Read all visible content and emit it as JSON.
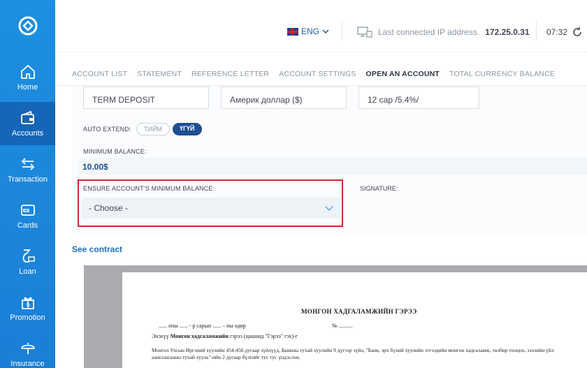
{
  "sidebar": {
    "items": [
      {
        "label": "Home",
        "icon": "home-icon"
      },
      {
        "label": "Accounts",
        "icon": "wallet-icon",
        "active": true
      },
      {
        "label": "Transaction",
        "icon": "transfer-arrows-icon"
      },
      {
        "label": "Cards",
        "icon": "card-icon"
      },
      {
        "label": "Loan",
        "icon": "loan-icon"
      },
      {
        "label": "Promotion",
        "icon": "gift-icon"
      },
      {
        "label": "Insurance",
        "icon": "umbrella-icon"
      }
    ]
  },
  "header": {
    "language": "ENG",
    "ip_label": "Last connected IP address.",
    "ip_value": "172.25.0.31",
    "time": "07:32"
  },
  "tabs": [
    {
      "label": "ACCOUNT LIST"
    },
    {
      "label": "STATEMENT"
    },
    {
      "label": "REFERENCE LETTER"
    },
    {
      "label": "ACCOUNT SETTINGS"
    },
    {
      "label": "OPEN AN ACCOUNT",
      "active": true
    },
    {
      "label": "TOTAL CURRENCY BALANCE"
    }
  ],
  "form": {
    "account_type": "TERM DEPOSIT",
    "currency": "Америк доллар ($)",
    "term": "12 сар /5.4%/",
    "auto_extend_label": "AUTO EXTEND:",
    "auto_extend_yes": "ТИЙМ",
    "auto_extend_no": "ҮГҮЙ",
    "min_balance_label": "MINIMUM BALANCE:",
    "min_balance_value": "10.00$",
    "ensure_label": "ENSURE ACCOUNT'S MINIMUM BALANCE:",
    "ensure_value": "- Choose -",
    "signature_label": "SIGNATURE:"
  },
  "contract": {
    "link": "See contract",
    "title": "МОНГОН ХАДГАЛАМЖИЙН ГЭРЭЭ",
    "date_line": "...... оны ...... - р сарын ...... – ны өдөр",
    "number_line": "№ ..........",
    "party_prefix": "Энэхүү",
    "party_bold": "Монгон хадгаламжийн",
    "party_suffix": "гэрээ (цаашид \"Гэрээ\" гэх)-г",
    "body": "Монгол Улсын Иргэний хуулийн 454-456 дугаар зүйлүүд, Банкны тухай хуулийн 9 дүгээр зүйл, \"Банк, эрх бүхий хуулийн этгээдийн монгон хадгаламж, төлбөр тооцоо, зээлийн үйл ажиллагааны тухай хууль\"-ийн 2 дугаар бүлгийг тус тус үндэслэн,"
  },
  "colors": {
    "sidebar": "#1a7fd6",
    "sidebar_active": "#1565b8",
    "accent": "#1d4f91",
    "highlight_border": "#d9262e"
  }
}
